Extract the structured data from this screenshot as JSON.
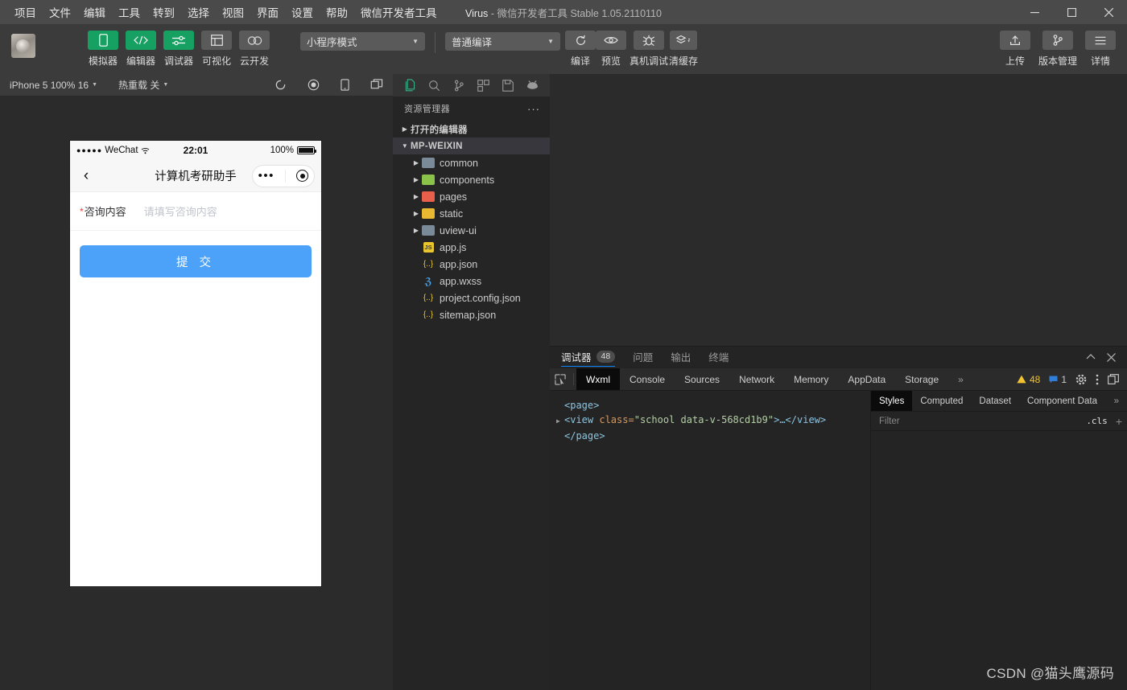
{
  "window": {
    "menus": [
      "项目",
      "文件",
      "编辑",
      "工具",
      "转到",
      "选择",
      "视图",
      "界面",
      "设置",
      "帮助",
      "微信开发者工具"
    ],
    "project_name": "Virus",
    "app_name": "微信开发者工具",
    "version": "Stable 1.05.2110110",
    "separator": "-",
    "controls": {
      "minimize": "—",
      "maximize": "▢",
      "close": "✕"
    }
  },
  "toolbar": {
    "mode_buttons": [
      {
        "label": "模拟器",
        "icon": "phone-icon",
        "style": "green"
      },
      {
        "label": "编辑器",
        "icon": "code-icon",
        "style": "green"
      },
      {
        "label": "调试器",
        "icon": "sliders-icon",
        "style": "green"
      },
      {
        "label": "可视化",
        "icon": "layout-icon",
        "style": "gray"
      },
      {
        "label": "云开发",
        "icon": "cloud-icon",
        "style": "gray"
      }
    ],
    "mode_select": "小程序模式",
    "compile_select": "普通编译",
    "action_buttons": [
      {
        "label": "编译",
        "icon": "refresh-icon"
      },
      {
        "label": "预览",
        "icon": "eye-icon"
      },
      {
        "label": "真机调试",
        "icon": "bug-icon"
      },
      {
        "label": "清缓存",
        "icon": "layers-icon"
      }
    ],
    "right_buttons": [
      {
        "label": "上传",
        "icon": "upload-icon"
      },
      {
        "label": "版本管理",
        "icon": "branch-icon"
      },
      {
        "label": "详情",
        "icon": "menu-icon"
      }
    ]
  },
  "simulator": {
    "device_select": "iPhone 5 100% 16",
    "hotreload_label": "热重载 关",
    "icons": [
      "rotate-icon",
      "record-icon",
      "device-icon",
      "windows-icon"
    ],
    "phone": {
      "carrier": "WeChat",
      "dots": "●●●●●",
      "time": "22:01",
      "battery_text": "100%",
      "nav_title": "计算机考研助手",
      "back_icon": "chevron-left-icon",
      "capsule": {
        "more": "•••",
        "target": "target-icon"
      },
      "form": {
        "required_mark": "*",
        "label": "咨询内容",
        "placeholder": "请填写咨询内容"
      },
      "submit_label": "提 交",
      "submit_color": "#4ca2f8"
    }
  },
  "explorer": {
    "activity_icons": [
      "files-icon",
      "search-icon",
      "source-control-icon",
      "extensions-icon",
      "save-icon",
      "debug-icon"
    ],
    "title": "资源管理器",
    "more": "···",
    "open_editors": "打开的编辑器",
    "project_root": "MP-WEIXIN",
    "tree": [
      {
        "name": "common",
        "type": "folder",
        "color": "#7a8a99"
      },
      {
        "name": "components",
        "type": "folder",
        "color": "#8bc34a"
      },
      {
        "name": "pages",
        "type": "folder",
        "color": "#e8604c"
      },
      {
        "name": "static",
        "type": "folder",
        "color": "#e8b931"
      },
      {
        "name": "uview-ui",
        "type": "folder",
        "color": "#7a8a99"
      },
      {
        "name": "app.js",
        "type": "js"
      },
      {
        "name": "app.json",
        "type": "json"
      },
      {
        "name": "app.wxss",
        "type": "wxss"
      },
      {
        "name": "project.config.json",
        "type": "json"
      },
      {
        "name": "sitemap.json",
        "type": "json"
      }
    ]
  },
  "devtools": {
    "panel_tabs": [
      {
        "label": "调试器",
        "count": "48",
        "active": true
      },
      {
        "label": "问题",
        "active": false
      },
      {
        "label": "输出",
        "active": false
      },
      {
        "label": "终端",
        "active": false
      }
    ],
    "collapse_icon": "chevron-up-icon",
    "close_icon": "close-icon",
    "inspect_icon": "inspect-icon",
    "tabs": [
      "Wxml",
      "Console",
      "Sources",
      "Network",
      "Memory",
      "AppData",
      "Storage"
    ],
    "active_tab": "Wxml",
    "overflow": "»",
    "warning_count": "48",
    "info_count": "1",
    "gear_icon": "gear-icon",
    "kebab_icon": "kebab-icon",
    "dock_icon": "dock-icon",
    "wxml": {
      "line1": "<page>",
      "line2_tag_open": "<view",
      "line2_attr": "class=",
      "line2_value": "\"school data-v-568cd1b9\"",
      "line2_close": ">…</view>",
      "line3": "</page>"
    },
    "styles": {
      "tabs": [
        "Styles",
        "Computed",
        "Dataset",
        "Component Data"
      ],
      "active_tab": "Styles",
      "overflow": "»",
      "filter_placeholder": "Filter",
      "cls_label": ".cls",
      "plus": "+"
    }
  },
  "watermark": "CSDN @猫头鹰源码"
}
